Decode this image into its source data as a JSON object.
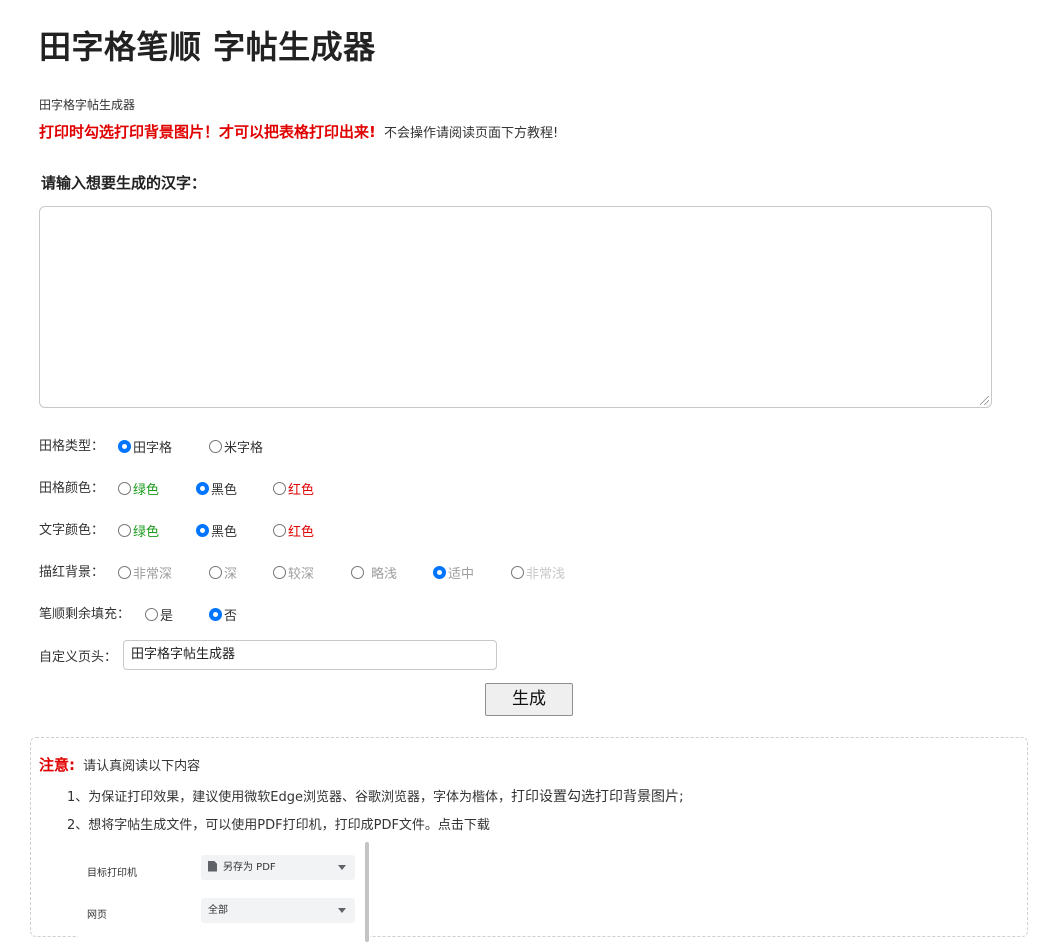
{
  "page": {
    "title": "田字格笔顺 字帖生成器",
    "subtitle": "田字格字帖生成器",
    "warning_strong": "打印时勾选打印背景图片！才可以把表格打印出来!",
    "warning_normal": "不会操作请阅读页面下方教程!"
  },
  "input": {
    "heading": "请输入想要生成的汉字：",
    "value": ""
  },
  "options": {
    "grid_type": {
      "label": "田格类型：",
      "choices": [
        "田字格",
        "米字格"
      ],
      "selected": "田字格"
    },
    "grid_color": {
      "label": "田格颜色：",
      "choices": [
        "绿色",
        "黑色",
        "红色"
      ],
      "selected": "黑色"
    },
    "text_color": {
      "label": "文字颜色：",
      "choices": [
        "绿色",
        "黑色",
        "红色"
      ],
      "selected": "黑色"
    },
    "trace_bg": {
      "label": "描红背景：",
      "choices": [
        "非常深",
        "深",
        "较深",
        "略浅",
        "适中",
        "非常浅"
      ],
      "selected": "适中"
    },
    "stroke_fill": {
      "label": "笔顺剩余填充：",
      "choices": [
        "是",
        "否"
      ],
      "selected": "否"
    },
    "custom_header": {
      "label": "自定义页头：",
      "value": "田字格字帖生成器"
    }
  },
  "generate_button": "生成",
  "notice": {
    "title": "注意:",
    "intro": "请认真阅读以下内容",
    "item1_a": "1、为保证打印效果，建议使用微软Edge浏览器、谷歌浏览器，字体为楷体，",
    "item1_b": "打印设置勾选打印背景图片;",
    "item2": "2、想将字帖生成文件，可以使用PDF打印机，打印成PDF文件。点击下载",
    "print_preview": {
      "printer_label": "目标打印机",
      "printer_value": "另存为 PDF",
      "pages_label": "网页",
      "pages_value": "全部"
    }
  },
  "colors": {
    "warning_red": "#e00000",
    "green": "#1a9a1a",
    "radio_blue": "#0075ff",
    "muted_gray": "#9e9e9e"
  }
}
